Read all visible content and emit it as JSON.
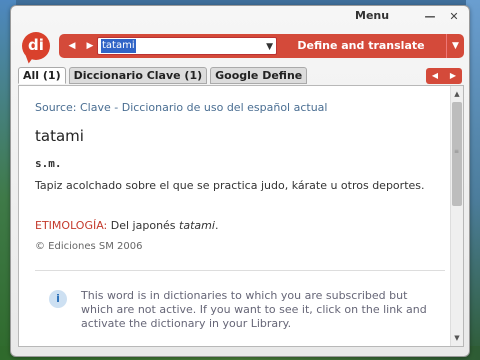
{
  "window": {
    "menu_label": "Menu",
    "minimize": "—",
    "close": "✕"
  },
  "logo": {
    "text": "di"
  },
  "search": {
    "back": "◀",
    "forward": "▶",
    "value": "tatami",
    "dropdown": "▼",
    "translate_label": "Define and translate",
    "translate_dropdown": "▼"
  },
  "tabs": [
    {
      "label": "All (1)",
      "active": true
    },
    {
      "label": "Diccionario Clave (1)",
      "active": false
    },
    {
      "label": "Google Define",
      "active": false
    }
  ],
  "tab_scroll": {
    "left": "◀",
    "right": "▶"
  },
  "entry": {
    "source_label": "Source:",
    "source_value": "Clave - Diccionario de uso del español actual",
    "headword": "tatami",
    "pos": "s.m.",
    "definition": "Tapiz acolchado sobre el que se practica judo, kárate u otros deportes.",
    "etym_label": "ETIMOLOGÍA:",
    "etym_text": "Del japonés",
    "etym_word": "tatami",
    "etym_end": ".",
    "copyright": "© Ediciones SM 2006"
  },
  "notice": {
    "icon": "i",
    "text": "This word is in dictionaries to which you are subscribed but which are not active. If you want to see it, click on the link and activate the dictionary in your Library."
  },
  "colors": {
    "accent": "#d44a3a",
    "link": "#4a6e92",
    "etym_label": "#c43a2c"
  }
}
